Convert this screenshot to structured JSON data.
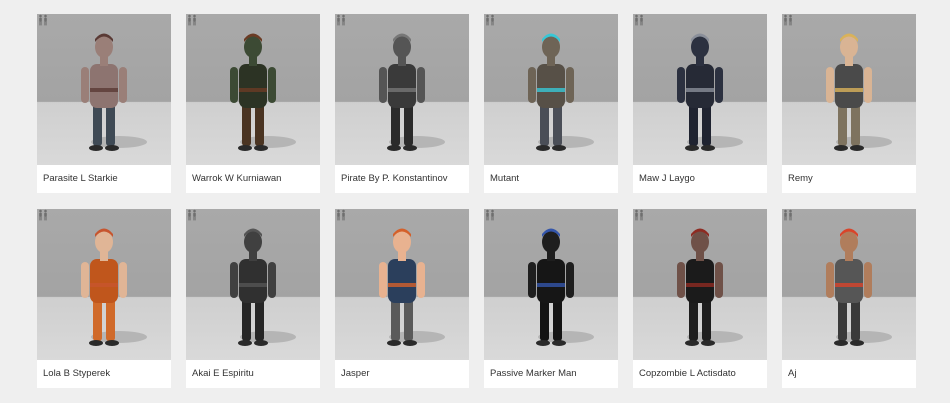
{
  "characters": [
    {
      "name": "Parasite L Starkie",
      "colors": {
        "skin": "#9a7f78",
        "top": "#8d7470",
        "bottom": "#3f4a55",
        "accent": "#5a3a35"
      }
    },
    {
      "name": "Warrok W Kurniawan",
      "colors": {
        "skin": "#3c4a34",
        "top": "#2c3324",
        "bottom": "#4a3422",
        "accent": "#6b3b24"
      }
    },
    {
      "name": "Pirate By P. Konstantinov",
      "colors": {
        "skin": "#555555",
        "top": "#3a3a3a",
        "bottom": "#2b2b2b",
        "accent": "#777777"
      }
    },
    {
      "name": "Mutant",
      "colors": {
        "skin": "#6e6456",
        "top": "#575047",
        "bottom": "#4a4e57",
        "accent": "#38c7d6"
      }
    },
    {
      "name": "Maw J Laygo",
      "colors": {
        "skin": "#2c3140",
        "top": "#262a36",
        "bottom": "#1f2330",
        "accent": "#8a8f9a"
      }
    },
    {
      "name": "Remy",
      "colors": {
        "skin": "#d9b494",
        "top": "#4a4a4a",
        "bottom": "#7e735f",
        "accent": "#d9b25a"
      }
    },
    {
      "name": "Lola B Styperek",
      "colors": {
        "skin": "#e0b596",
        "top": "#c0561c",
        "bottom": "#d06a2a",
        "accent": "#c7552e"
      }
    },
    {
      "name": "Akai E Espiritu",
      "colors": {
        "skin": "#404040",
        "top": "#303030",
        "bottom": "#262626",
        "accent": "#555555"
      }
    },
    {
      "name": "Jasper",
      "colors": {
        "skin": "#e8b290",
        "top": "#2b3f5c",
        "bottom": "#5a5a5a",
        "accent": "#d4602a"
      }
    },
    {
      "name": "Passive Marker Man",
      "colors": {
        "skin": "#1e1e1e",
        "top": "#161616",
        "bottom": "#141414",
        "accent": "#3355aa"
      }
    },
    {
      "name": "Copzombie L Actisdato",
      "colors": {
        "skin": "#6f5148",
        "top": "#1b1b1b",
        "bottom": "#1e1e1e",
        "accent": "#8e2b22"
      }
    },
    {
      "name": "Aj",
      "colors": {
        "skin": "#b07d5c",
        "top": "#565656",
        "bottom": "#3a3a3a",
        "accent": "#d9442a"
      }
    }
  ]
}
